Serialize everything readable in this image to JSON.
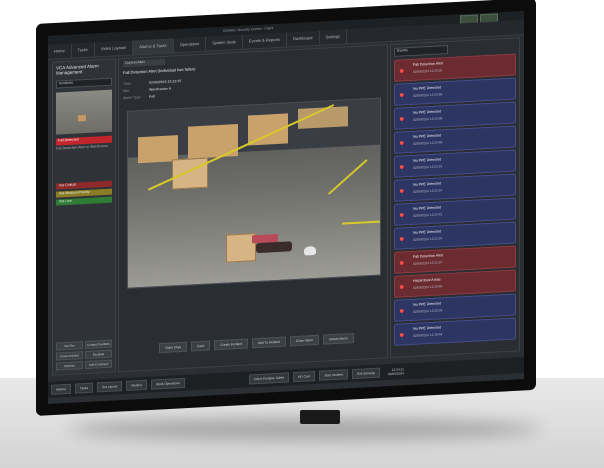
{
  "window": {
    "title": "Genetec Security Center - Client"
  },
  "menu": [
    "Home",
    "Tasks",
    "Video Layouts",
    "Alarms & Tasks",
    "Operations",
    "System Stats",
    "Events & Reports",
    "Dashboard",
    "Settings"
  ],
  "left_panel": {
    "title": "VCA Advanced Alarm Management",
    "selector": "Incidents",
    "alert_label": "Fall Detected",
    "alert_text": "Fall Detection Alert in Warehouse",
    "actions": [
      "Set Critical",
      "Set Medium Priority",
      "Set Low"
    ],
    "grid_buttons": [
      "Set Fire",
      "Contact Facilities",
      "Close Incident",
      "Escalate",
      "Dismiss",
      "Add Comment"
    ]
  },
  "center": {
    "tab": "Current Alert",
    "alert_title": "Fall Detection Alert (Individual has fallen)",
    "meta": [
      {
        "k": "Time",
        "v": "02/09/2024 12:22:07"
      },
      {
        "k": "Site",
        "v": "Warehouse A"
      },
      {
        "k": "Alarm Type",
        "v": "Fall"
      }
    ],
    "buttons": [
      "Video Clips",
      "Save",
      "Create Incident",
      "Add To Incident",
      "Close Alarm",
      "Isolate Alarm"
    ]
  },
  "right": {
    "selector": "Events",
    "alerts": [
      {
        "t": "Fall Detection Alert",
        "ts": "02/09/2024 12:25:02",
        "c": "red"
      },
      {
        "t": "No PPE Detected",
        "ts": "02/09/2024 12:24:50",
        "c": "blue"
      },
      {
        "t": "No PPE Detected",
        "ts": "02/09/2024 12:24:08",
        "c": "blue"
      },
      {
        "t": "No PPE Detected",
        "ts": "02/09/2024 12:23:40",
        "c": "blue"
      },
      {
        "t": "No PPE Detected",
        "ts": "02/09/2024 12:23:15",
        "c": "blue"
      },
      {
        "t": "No PPE Detected",
        "ts": "02/09/2024 12:22:57",
        "c": "blue"
      },
      {
        "t": "No PPE Detected",
        "ts": "02/09/2024 12:22:41",
        "c": "blue"
      },
      {
        "t": "No PPE Detected",
        "ts": "02/09/2024 12:22:07",
        "c": "blue"
      },
      {
        "t": "Fall Detection Alert",
        "ts": "02/09/2024 12:21:07",
        "c": "red"
      },
      {
        "t": "Hazardous Areas",
        "ts": "02/09/2024 12:20:48",
        "c": "red"
      },
      {
        "t": "No PPE Detected",
        "ts": "02/09/2024 12:20:29",
        "c": "blue"
      },
      {
        "t": "No PPE Detected",
        "ts": "02/09/2024 12:19:44",
        "c": "blue"
      }
    ]
  },
  "taskbar": {
    "items": [
      "Alarms",
      "Tasks",
      "Set Layout",
      "Monitor",
      "Work Operations",
      "Client Portable Tablet",
      "HD Cam",
      "Start Incident",
      "Exit Synergy"
    ],
    "time": "12:24:11",
    "date": "02/09/2024"
  },
  "colors": {
    "alert_red": "#6b2b30",
    "alert_blue": "#2d3563",
    "accent_red": "#c0262b"
  }
}
